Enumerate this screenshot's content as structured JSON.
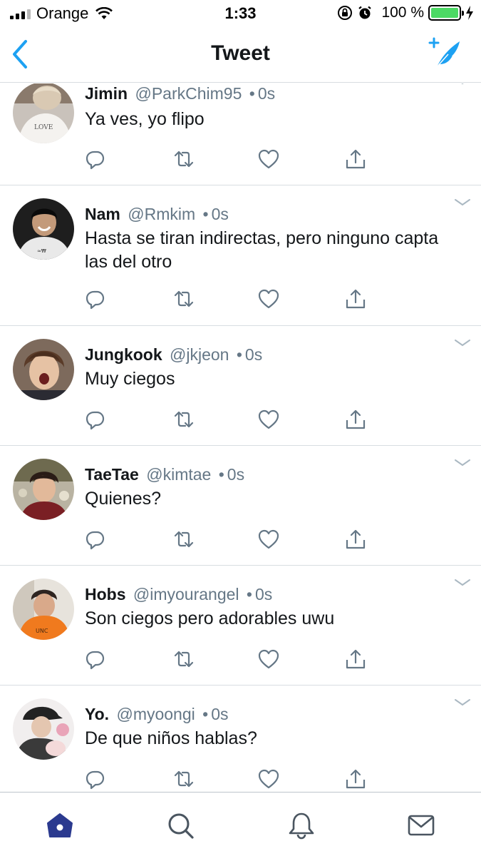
{
  "status_bar": {
    "carrier": "Orange",
    "time": "1:33",
    "battery_percent": "100 %",
    "battery_level": 1.0,
    "battery_color": "#4cd964"
  },
  "nav": {
    "title": "Tweet",
    "back_icon": "back-chevron-icon",
    "compose_icon": "compose-feather-icon",
    "accent_color": "#1da1f2"
  },
  "tweets": [
    {
      "name": "Jimin",
      "handle": "@ParkChim95",
      "dot": "•",
      "time": "0s",
      "text": "Ya ves, yo flipo"
    },
    {
      "name": "Nam",
      "handle": "@Rmkim",
      "dot": "•",
      "time": "0s",
      "text": "Hasta se tiran indirectas, pero ninguno capta las del otro"
    },
    {
      "name": "Jungkook",
      "handle": "@jkjeon",
      "dot": "•",
      "time": "0s",
      "text": "Muy ciegos"
    },
    {
      "name": "TaeTae",
      "handle": "@kimtae",
      "dot": "•",
      "time": "0s",
      "text": "Quienes?"
    },
    {
      "name": "Hobs",
      "handle": "@imyourangel",
      "dot": "•",
      "time": "0s",
      "text": "Son ciegos pero adorables uwu"
    },
    {
      "name": "Yo.",
      "handle": "@myoongi",
      "dot": "•",
      "time": "0s",
      "text": "De que niños hablas?"
    }
  ],
  "tweet_actions": [
    "reply-icon",
    "retweet-icon",
    "like-icon",
    "share-icon"
  ],
  "tab_bar": {
    "tabs": [
      "home-icon",
      "search-icon",
      "notifications-icon",
      "messages-icon"
    ],
    "active_tab": "home-icon",
    "active_color": "#2b3a8f"
  }
}
